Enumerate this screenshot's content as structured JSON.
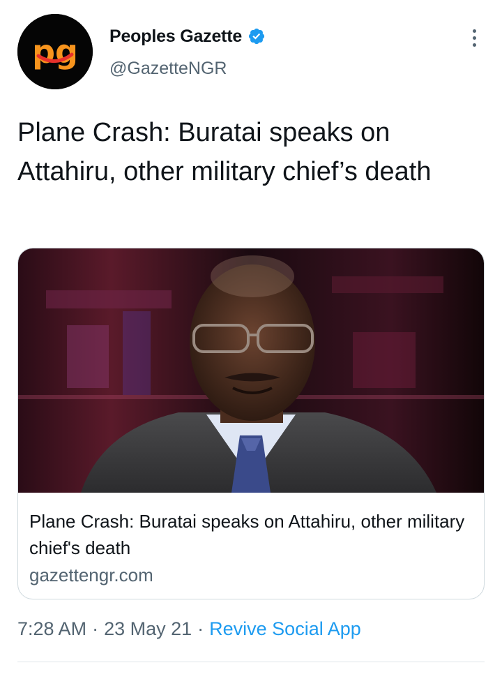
{
  "account": {
    "avatar_text": "pg",
    "display_name": "Peoples Gazette",
    "handle": "@GazetteNGR",
    "verified_icon": "verified-badge-icon",
    "more_icon": "more-vertical-icon"
  },
  "tweet": {
    "text": "Plane Crash: Buratai speaks on Attahiru, other military chief’s death"
  },
  "card": {
    "image_icon": "article-photo",
    "title": "Plane Crash: Buratai speaks on Attahiru, other military chief's death",
    "domain": "gazettengr.com"
  },
  "meta": {
    "time": "7:28 AM",
    "separator": "·",
    "date": "23 May 21",
    "source": "Revive Social App"
  },
  "colors": {
    "accent": "#1d9bf0",
    "brand_orange": "#f7941d",
    "text_primary": "#0f1419",
    "text_secondary": "#536471"
  }
}
